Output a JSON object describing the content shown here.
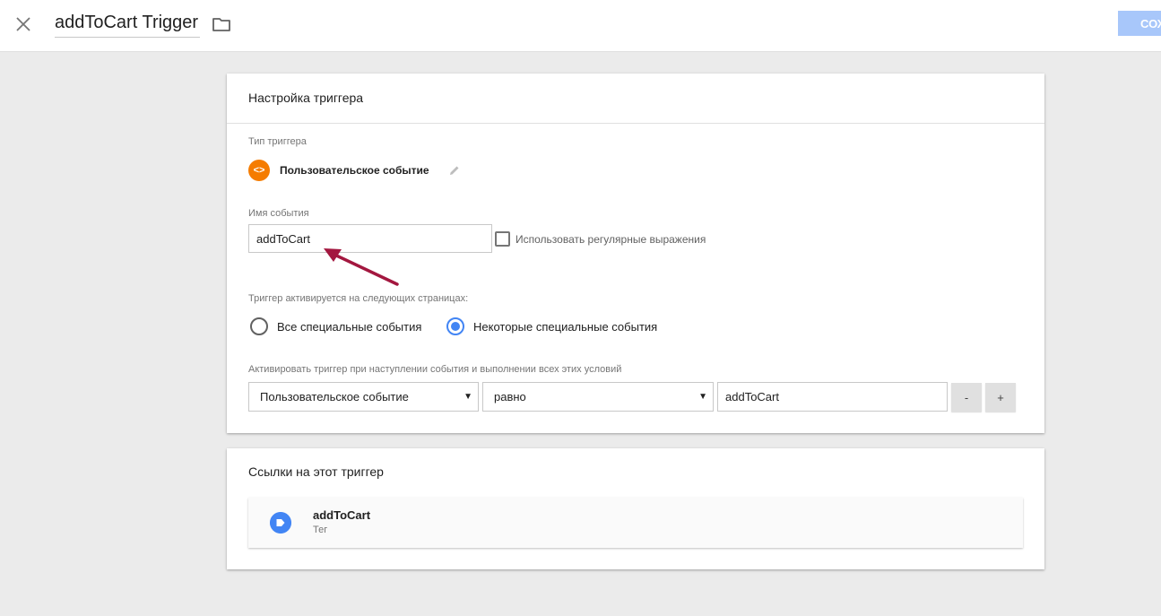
{
  "header": {
    "title": "addToCart Trigger",
    "save_label": "Сох",
    "close_icon": "close-icon",
    "folder_icon": "folder-icon"
  },
  "config": {
    "title": "Настройка триггера",
    "trigger_type_label": "Тип триггера",
    "trigger_type_name": "Пользовательское событие",
    "trigger_type_icon": "code-brackets-icon",
    "trigger_type_icon_glyph": "<>",
    "event_name_label": "Имя события",
    "event_name_value": "addToCart",
    "regex_label": "Использовать регулярные выражения",
    "regex_checked": false,
    "fires_on_label": "Триггер активируется на следующих страницах:",
    "radio_all_label": "Все специальные события",
    "radio_some_label": "Некоторые специальные события",
    "selected_radio": "some",
    "condition_label": "Активировать триггер при наступлении события и выполнении всех этих условий",
    "condition": {
      "variable": "Пользовательское событие",
      "operator": "равно",
      "value": "addToCart"
    },
    "minus_label": "-",
    "plus_label": "+"
  },
  "references": {
    "title": "Ссылки на этот триггер",
    "items": [
      {
        "name": "addToCart",
        "type": "Тег",
        "icon": "tag-icon"
      }
    ]
  },
  "colors": {
    "accent": "#4285f4",
    "trigger_icon": "#f57c00",
    "annotation_arrow": "#a3173f",
    "save_button": "#a8c7fa"
  }
}
